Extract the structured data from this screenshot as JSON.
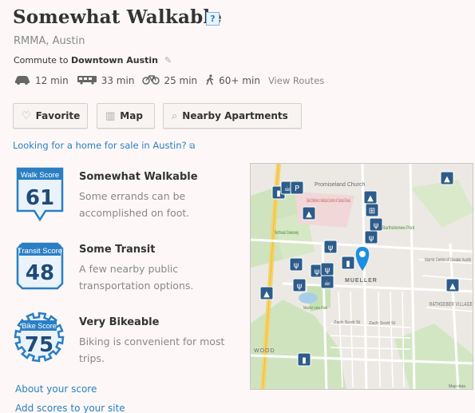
{
  "header": {
    "title": "Somewhat Walkable",
    "help_label": "?",
    "subtitle": "RMMA, Austin"
  },
  "commute": {
    "prefix": "Commute to",
    "destination": "Downtown Austin",
    "modes": [
      {
        "icon": "car-icon",
        "value": "12 min"
      },
      {
        "icon": "bus-icon",
        "value": "33 min"
      },
      {
        "icon": "bike-icon",
        "value": "25 min"
      },
      {
        "icon": "walk-icon",
        "value": "60+ min"
      }
    ],
    "view_routes": "View Routes"
  },
  "actions": {
    "favorite": "Favorite",
    "map": "Map",
    "nearby": "Nearby Apartments"
  },
  "for_sale_link": "Looking for a home for sale in Austin?",
  "scores": [
    {
      "badge_label": "Walk Score",
      "value": "61",
      "title": "Somewhat Walkable",
      "desc": "Some errands can be accomplished on foot."
    },
    {
      "badge_label": "Transit Score",
      "value": "48",
      "title": "Some Transit",
      "desc": "A few nearby public transportation options."
    },
    {
      "badge_label": "Bike Score",
      "value": "75",
      "title": "Very Bikeable",
      "desc": "Biking is convenient for most trips."
    }
  ],
  "links": {
    "about": "About your score",
    "add": "Add scores to your site"
  },
  "map": {
    "labels": {
      "church": "Promiseland Church",
      "medical": "Dell Children's Medical Center of Central Texas",
      "greenway": "Northeast Greenway",
      "grocery": "Bartholomew Pool",
      "mueller": "MUELLER",
      "islamic": "Islamic Center of Greater Austin",
      "rathgeber": "RATHGEBER VILLAGE",
      "lake": "Mueller Lake Park",
      "zach1": "Zach Scott St",
      "zach2": "Zach Scott St",
      "woodrow": "WOOD",
      "mapdata": "Map data"
    }
  },
  "colors": {
    "link": "#2a7fc4",
    "badge": "#2a7fc4",
    "badge_light": "#e8f2fa",
    "pin": "#1a8fe3"
  }
}
